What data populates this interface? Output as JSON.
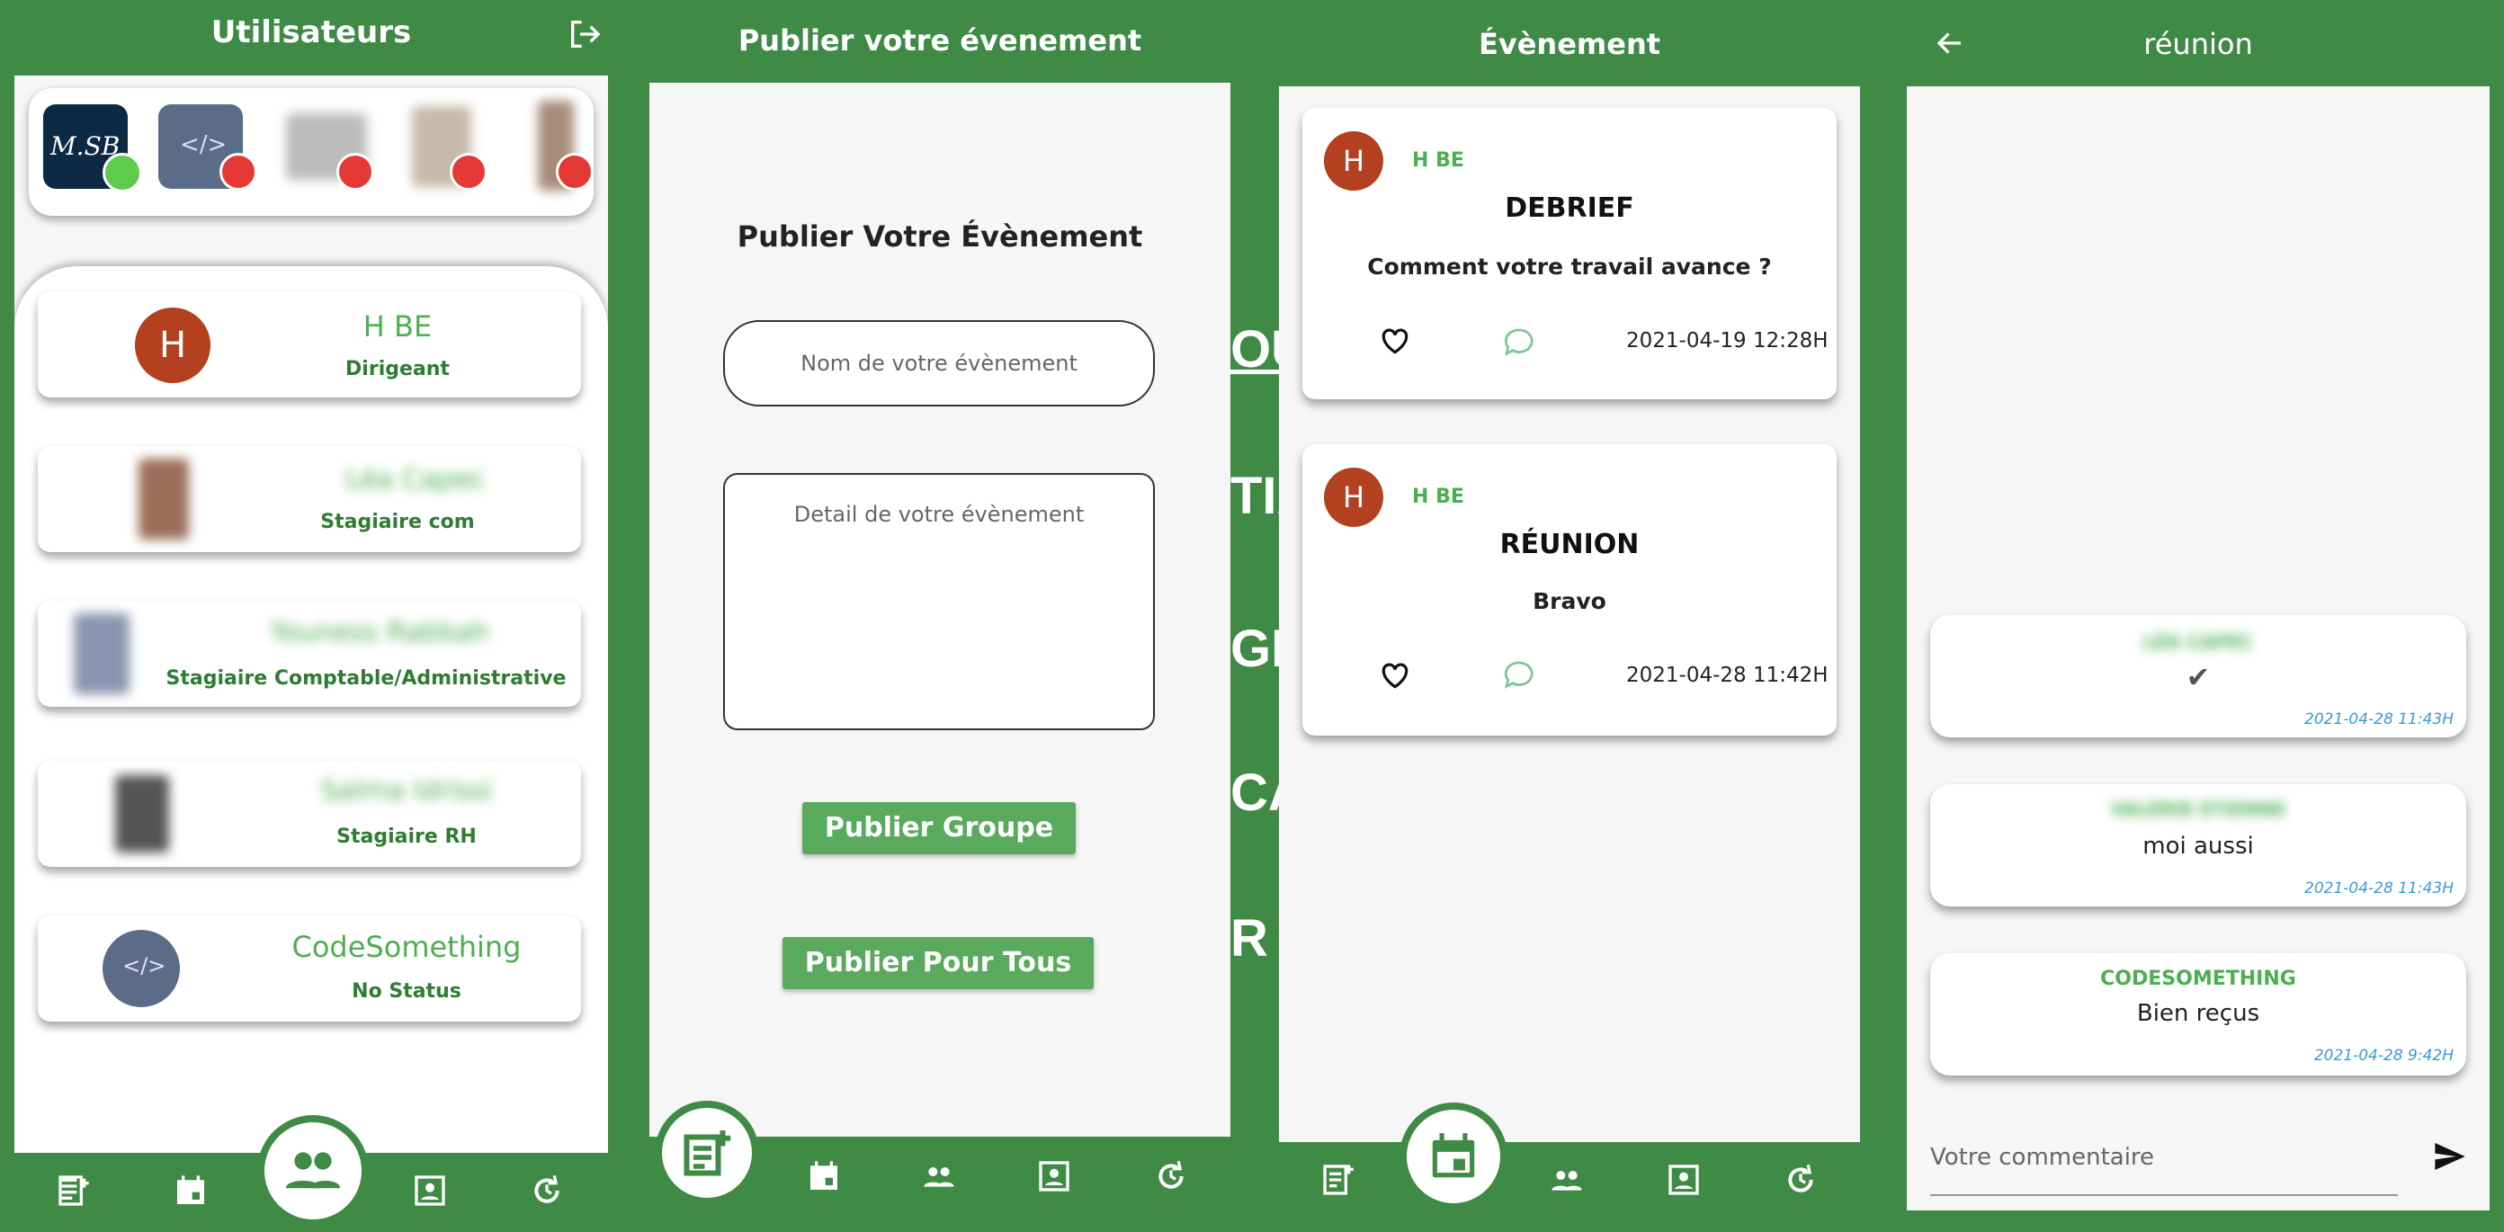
{
  "background_menu": [
    "OUC",
    "TIA",
    "GEN",
    "CA",
    "R E"
  ],
  "users_screen": {
    "title": "Utilisateurs",
    "users": [
      {
        "name": "H BE",
        "role": "Dirigeant",
        "initial": "H"
      },
      {
        "name": "Léa Capec",
        "role": "Stagiaire com"
      },
      {
        "name": "Youness Rabbah",
        "role": "Stagiaire Comptable/Administrative"
      },
      {
        "name": "Salma Idrissi",
        "role": "Stagiaire RH"
      },
      {
        "name": "CodeSomething",
        "role": "No Status"
      }
    ],
    "story_avatar_text": "M.SB"
  },
  "publish_screen": {
    "title": "Publier votre évenement",
    "heading": "Publier Votre Évènement",
    "name_placeholder": "Nom de votre évènement",
    "detail_placeholder": "Detail de votre évènement",
    "btn_group": "Publier Groupe",
    "btn_all": "Publier Pour Tous"
  },
  "events_screen": {
    "title": "Évènement",
    "events": [
      {
        "author": "H BE",
        "initial": "H",
        "title": "DEBRIEF",
        "body": "Comment votre travail avance ?",
        "date": "2021-04-19 12:28H"
      },
      {
        "author": "H BE",
        "initial": "H",
        "title": "RÉUNION",
        "body": "Bravo",
        "date": "2021-04-28 11:42H"
      }
    ]
  },
  "comments_screen": {
    "title": "réunion",
    "comments": [
      {
        "author": "LÉA CAPEC",
        "text": "✔",
        "time": "2021-04-28 11:43H"
      },
      {
        "author": "VALÉRIE ETIENNE",
        "text": "moi aussi",
        "time": "2021-04-28 11:43H"
      },
      {
        "author": "CODESOMETHING",
        "text": "Bien reçus",
        "time": "2021-04-28 9:42H"
      }
    ],
    "input_placeholder": "Votre commentaire"
  },
  "colors": {
    "primary": "#3f8a45",
    "accent": "#4caf50",
    "avatar": "#b3401f"
  }
}
